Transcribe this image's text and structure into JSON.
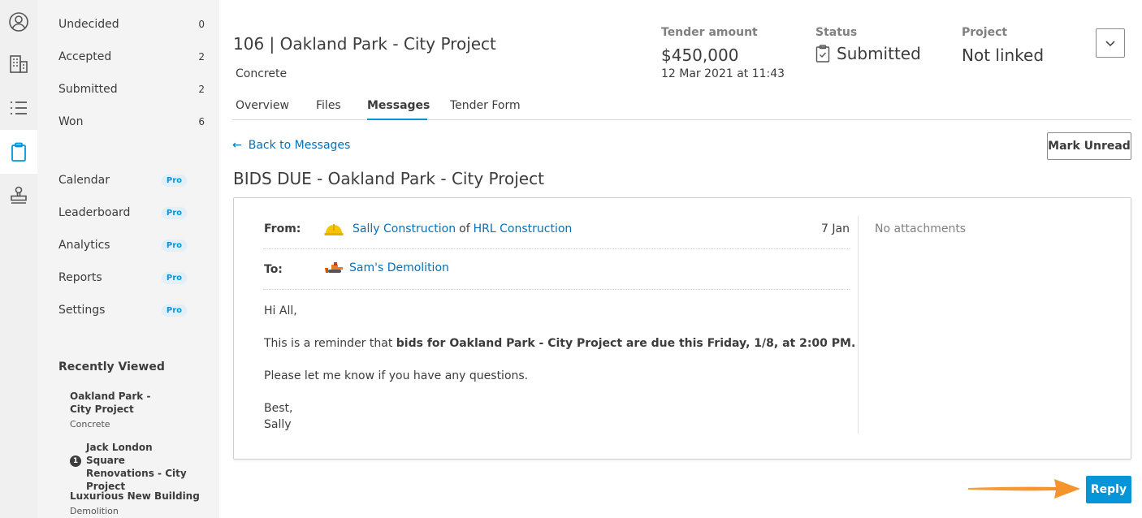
{
  "rail": {
    "icons": [
      "user-circle-icon",
      "building-icon",
      "list-icon",
      "clipboard-icon",
      "stamp-icon"
    ]
  },
  "sidebar": {
    "status_items": [
      {
        "label": "Undecided",
        "count": "0"
      },
      {
        "label": "Accepted",
        "count": "2"
      },
      {
        "label": "Submitted",
        "count": "2"
      },
      {
        "label": "Won",
        "count": "6"
      }
    ],
    "pro_items": [
      {
        "label": "Calendar",
        "badge": "Pro"
      },
      {
        "label": "Leaderboard",
        "badge": "Pro"
      },
      {
        "label": "Analytics",
        "badge": "Pro"
      },
      {
        "label": "Reports",
        "badge": "Pro"
      },
      {
        "label": "Settings",
        "badge": "Pro"
      }
    ],
    "recent_title": "Recently Viewed",
    "recent": [
      {
        "title": "Oakland Park - City Project",
        "sub": "Concrete"
      },
      {
        "title": "Jack London Square Renovations - City Project",
        "badge": "1"
      },
      {
        "title": "Luxurious New Building",
        "sub": "Demolition"
      }
    ]
  },
  "header": {
    "title": "106 | Oakland Park - City Project",
    "subtitle": "Concrete",
    "tender_label": "Tender amount",
    "tender_value": "$450,000",
    "tender_date": "12 Mar 2021 at 11:43 a...",
    "status_label": "Status",
    "status_value": "Submitted",
    "project_label": "Project",
    "project_value": "Not linked"
  },
  "tabs": [
    "Overview",
    "Files",
    "Messages",
    "Tender Form"
  ],
  "active_tab": "Messages",
  "back_link": "Back to Messages",
  "mark_unread": "Mark Unread",
  "message": {
    "subject": "BIDS DUE - Oakland Park - City Project",
    "from_label": "From:",
    "from_name": "Sally Construction",
    "from_of": "of",
    "from_company": "HRL Construction",
    "date": "7 Jan",
    "to_label": "To:",
    "to_name": "Sam's Demolition",
    "attachments": "No attachments",
    "greeting": "Hi All,",
    "line1_pre": "This is a reminder that ",
    "line1_bold": "bids for Oakland Park - City Project are due this Friday, 1/8, at 2:00 PM.",
    "line2": "Please let me know if you have any questions.",
    "signoff": "Best,",
    "signature": "Sally"
  },
  "reply_label": "Reply",
  "colors": {
    "accent": "#0696d7",
    "link": "#0a6fb5",
    "arrow": "#f5922a"
  }
}
